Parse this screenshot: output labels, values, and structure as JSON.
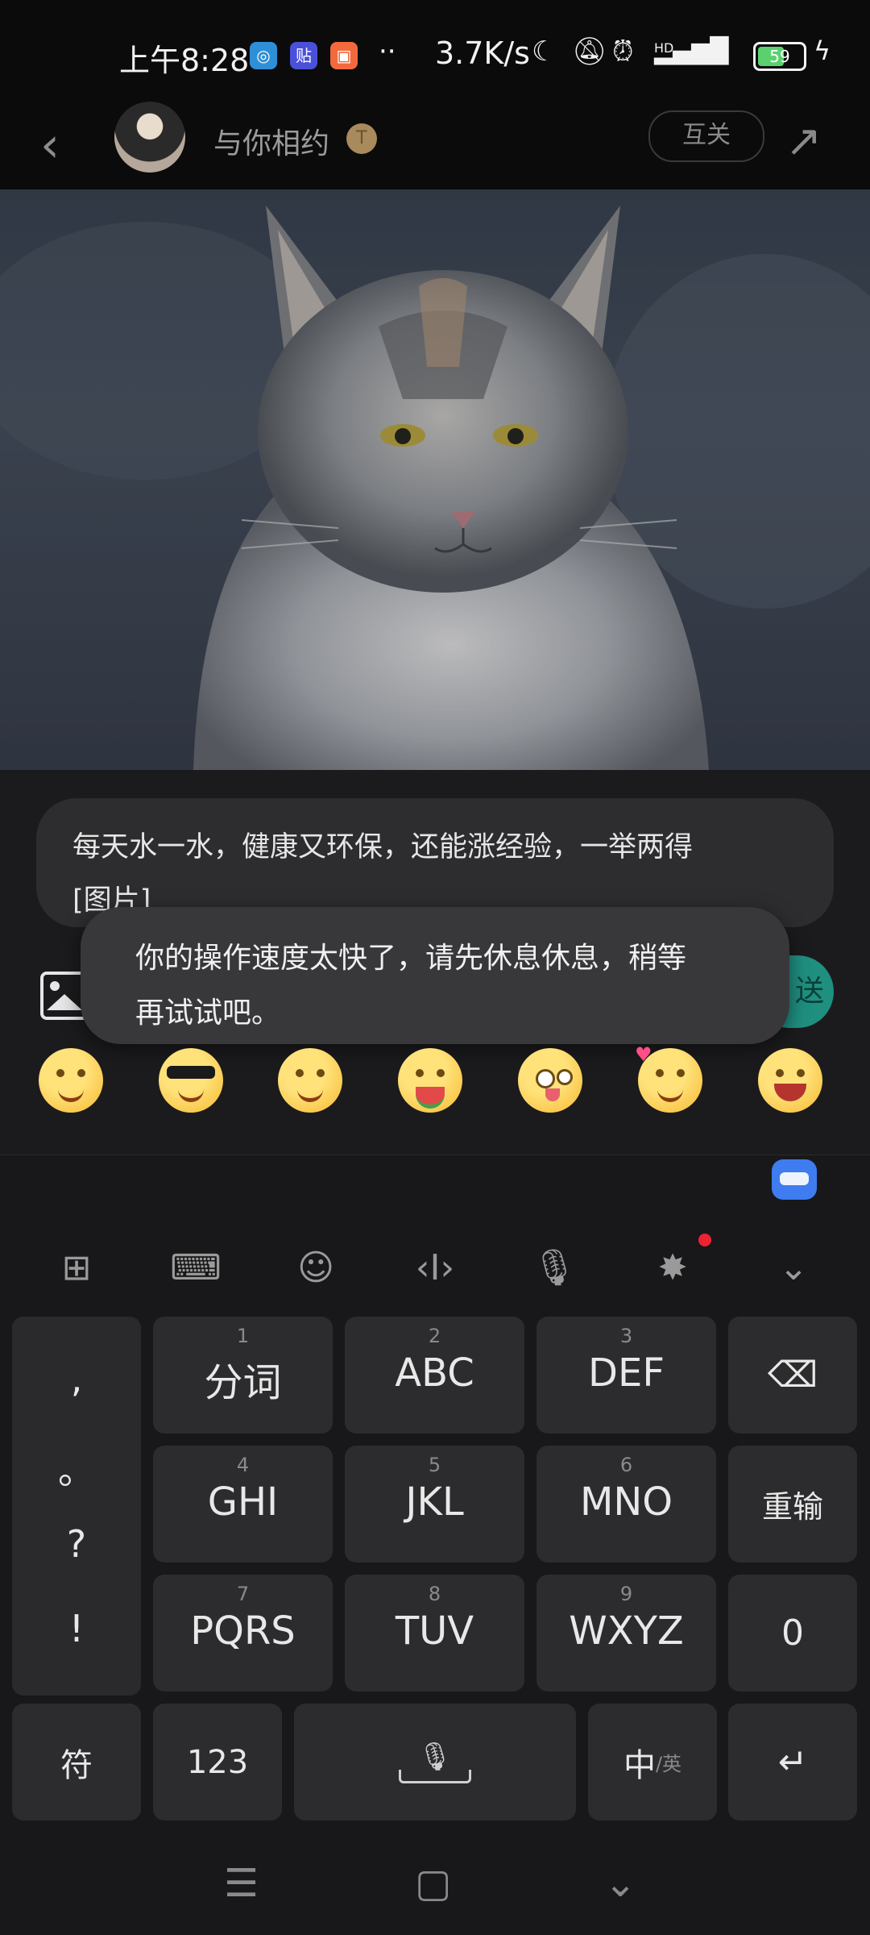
{
  "status_bar": {
    "time": "上午8:28",
    "speed": "3.7K/s",
    "app_icons": [
      "maps-app-icon",
      "tieba-app-icon",
      "shopping-app-icon"
    ],
    "more": "··",
    "network": "HD",
    "battery": "59"
  },
  "header": {
    "username": "与你相约",
    "badge": "T",
    "mutual_label": "互关"
  },
  "chat": {
    "draft_text": "每天水一水，健康又环保，还能涨经验，一举两得",
    "draft_tail": "[图片]",
    "toast_line1": "你的操作速度太快了，请先休息休息，稍等",
    "toast_line2": "再试试吧。",
    "send_label": "送"
  },
  "emoji_bar": [
    "smile",
    "cool-sunglasses",
    "shy",
    "eating-watermelon",
    "crazy-tongue",
    "love-heart",
    "grin"
  ],
  "keyboard": {
    "punct": [
      ",",
      "。",
      "?",
      "!"
    ],
    "rows": [
      [
        {
          "num": "1",
          "label": "分词"
        },
        {
          "num": "2",
          "label": "ABC"
        },
        {
          "num": "3",
          "label": "DEF"
        }
      ],
      [
        {
          "num": "4",
          "label": "GHI"
        },
        {
          "num": "5",
          "label": "JKL"
        },
        {
          "num": "6",
          "label": "MNO"
        }
      ],
      [
        {
          "num": "7",
          "label": "PQRS"
        },
        {
          "num": "8",
          "label": "TUV"
        },
        {
          "num": "9",
          "label": "WXYZ"
        }
      ]
    ],
    "reinput": "重输",
    "zero": "0",
    "symbol": "符",
    "num_mode": "123",
    "lang": "中",
    "lang_alt": "/英"
  }
}
